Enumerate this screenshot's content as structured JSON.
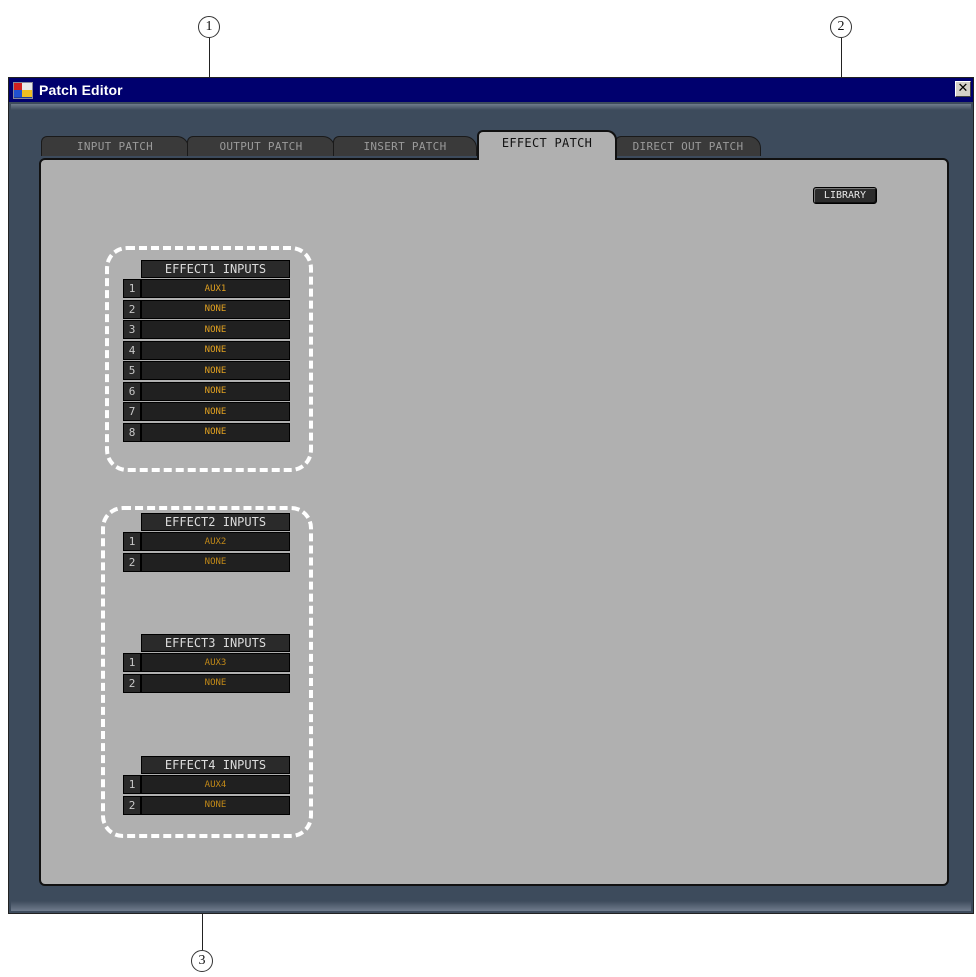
{
  "window": {
    "title": "Patch Editor",
    "close_label": "✕"
  },
  "tabs": [
    {
      "label": "INPUT PATCH",
      "active": false
    },
    {
      "label": "OUTPUT PATCH",
      "active": false
    },
    {
      "label": "INSERT PATCH",
      "active": false
    },
    {
      "label": "EFFECT PATCH",
      "active": true
    },
    {
      "label": "DIRECT OUT PATCH",
      "active": false
    }
  ],
  "library_label": "LIBRARY",
  "callouts": [
    "1",
    "2",
    "3"
  ],
  "effects": [
    {
      "header": "EFFECT1  INPUTS",
      "rows": [
        {
          "num": "1",
          "value": "AUX1"
        },
        {
          "num": "2",
          "value": "NONE"
        },
        {
          "num": "3",
          "value": "NONE"
        },
        {
          "num": "4",
          "value": "NONE"
        },
        {
          "num": "5",
          "value": "NONE"
        },
        {
          "num": "6",
          "value": "NONE"
        },
        {
          "num": "7",
          "value": "NONE"
        },
        {
          "num": "8",
          "value": "NONE"
        }
      ]
    },
    {
      "header": "EFFECT2  INPUTS",
      "rows": [
        {
          "num": "1",
          "value": "AUX2"
        },
        {
          "num": "2",
          "value": "NONE"
        }
      ]
    },
    {
      "header": "EFFECT3  INPUTS",
      "rows": [
        {
          "num": "1",
          "value": "AUX3"
        },
        {
          "num": "2",
          "value": "NONE"
        }
      ]
    },
    {
      "header": "EFFECT4  INPUTS",
      "rows": [
        {
          "num": "1",
          "value": "AUX4"
        },
        {
          "num": "2",
          "value": "NONE"
        }
      ]
    }
  ],
  "colors": {
    "value_text": "#e0a020",
    "value_text_dim": "#c08818",
    "panel_bg": "#b0b0b0",
    "titlebar": "#00006e"
  }
}
